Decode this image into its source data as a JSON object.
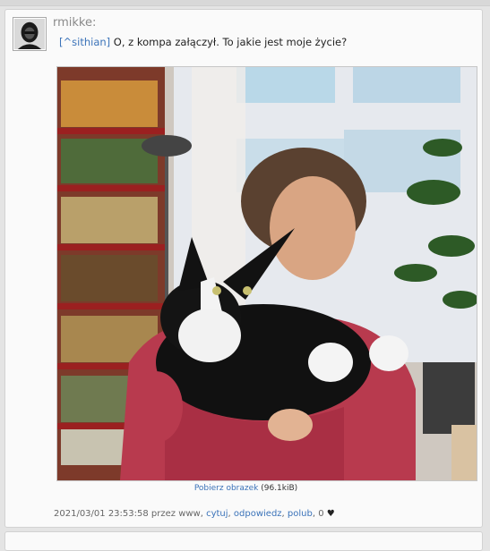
{
  "post": {
    "username": "rmikke:",
    "mention_open": "[",
    "mention": "^sithian",
    "mention_close": "]",
    "message": " O, z kompa załączył. To jakie jest moje życie?",
    "download_link": "Pobierz obrazek",
    "download_size": " (96.1kiB)",
    "timestamp": "2021/03/01 23:53:58 przez www",
    "sep1": ", ",
    "action_quote": "cytuj",
    "sep2": ", ",
    "action_reply": "odpowiedz",
    "sep3": ", ",
    "action_like": "polub",
    "like_count": ", 0 "
  },
  "icons": {
    "avatar": "user-avatar",
    "heart": "heart-icon"
  },
  "colors": {
    "link": "#3b73b9",
    "background": "#e4e4e4",
    "card": "#fafafa"
  }
}
